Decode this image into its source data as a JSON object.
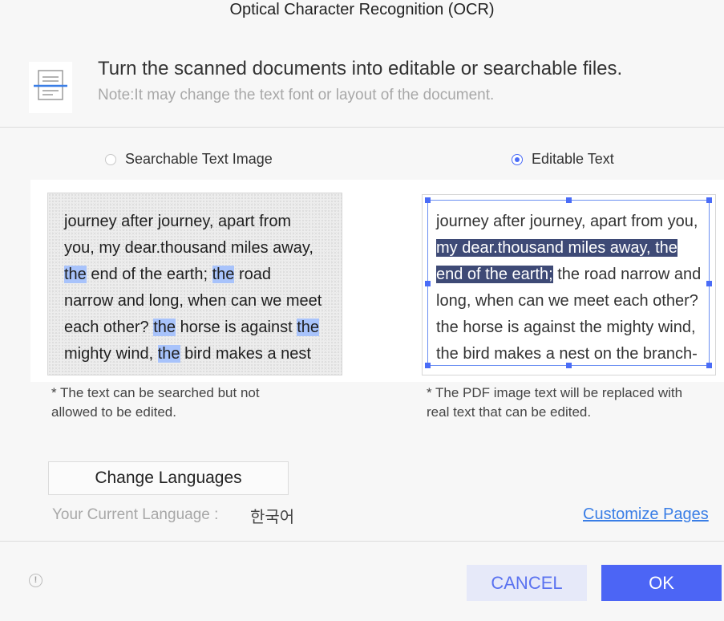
{
  "dialog": {
    "title": "Optical Character Recognition (OCR)",
    "headline": "Turn the scanned documents into editable or searchable files.",
    "note": "Note:It may change the text font or layout of the document."
  },
  "options": {
    "searchable": {
      "label": "Searchable Text Image",
      "selected": false
    },
    "editable": {
      "label": "Editable Text",
      "selected": true
    }
  },
  "preview_searchable": {
    "lines": [
      [
        {
          "t": "journey after journey, apart from",
          "h": false
        }
      ],
      [
        {
          "t": "you, my dear.thousand miles away,",
          "h": false
        }
      ],
      [
        {
          "t": "the",
          "h": true
        },
        {
          "t": " end of the earth; ",
          "h": false
        },
        {
          "t": "the",
          "h": true
        },
        {
          "t": " road",
          "h": false
        }
      ],
      [
        {
          "t": "narrow and long, when can we meet",
          "h": false
        }
      ],
      [
        {
          "t": "each other? ",
          "h": false
        },
        {
          "t": "the",
          "h": true
        },
        {
          "t": " horse is against ",
          "h": false
        },
        {
          "t": "the",
          "h": true
        }
      ],
      [
        {
          "t": "mighty wind, ",
          "h": false
        },
        {
          "t": "the",
          "h": true
        },
        {
          "t": " bird makes a nest",
          "h": false
        }
      ]
    ],
    "caption": "* The text can be searched but not allowed to be edited."
  },
  "preview_editable": {
    "lines": [
      [
        {
          "t": "journey after journey, apart from you,",
          "h": false
        }
      ],
      [
        {
          "t": "my dear.thousand miles away, the",
          "h": true
        }
      ],
      [
        {
          "t": "end of the earth;",
          "h": true
        },
        {
          "t": " the road narrow and",
          "h": false
        }
      ],
      [
        {
          "t": "long, when can we meet each other?",
          "h": false
        }
      ],
      [
        {
          "t": "the horse is against the mighty wind,",
          "h": false
        }
      ],
      [
        {
          "t": "the bird makes a nest on the branch-",
          "h": false
        }
      ]
    ],
    "caption": "* The PDF image text will be replaced with real text that can be edited."
  },
  "language": {
    "button_label": "Change Languages",
    "current_label": "Your Current Language :",
    "current_value": "한국어"
  },
  "customize_link": "Customize Pages",
  "footer": {
    "info_icon": "!",
    "cancel_label": "CANCEL",
    "ok_label": "OK"
  },
  "colors": {
    "accent": "#4c65f5",
    "search_highlight": "#a8c3fb",
    "edit_selection": "#3e4a76",
    "link": "#3a7ee6"
  }
}
